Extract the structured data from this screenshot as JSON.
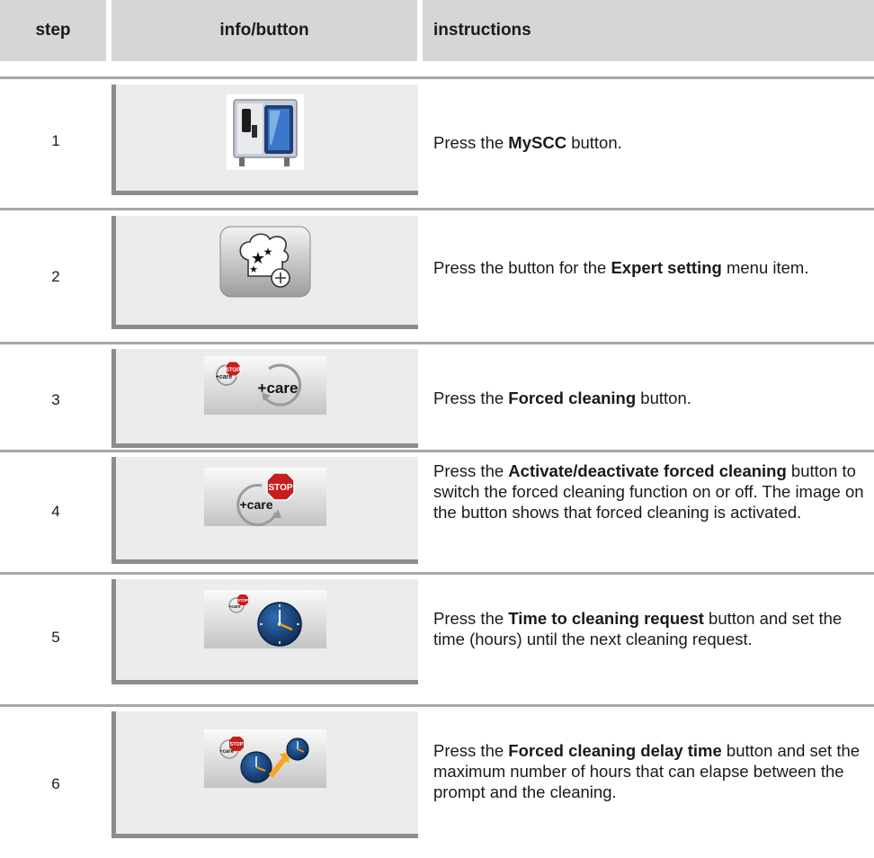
{
  "header": {
    "step": "step",
    "info": "info/button",
    "instructions": "instructions"
  },
  "rows": [
    {
      "step": "1",
      "pre": "Press the ",
      "bold": "MySCC",
      "post": " button.",
      "icon": "myscc-oven-icon"
    },
    {
      "step": "2",
      "pre": "Press the button for the ",
      "bold": "Expert setting",
      "post": " menu item.",
      "icon": "chef-hat-stars-plus-icon"
    },
    {
      "step": "3",
      "pre": "Press the ",
      "bold": "Forced cleaning",
      "post": " button.",
      "icon": "care-stop-cycle-icon"
    },
    {
      "step": "4",
      "pre": "Press the ",
      "bold": "Activate/deactivate forced cleaning",
      "post": " button to switch the forced cleaning function on or off. The image on the button shows that forced cleaning is activated.",
      "icon": "care-stop-large-icon"
    },
    {
      "step": "5",
      "pre": "Press the ",
      "bold": "Time to cleaning request",
      "post": " button and set the time (hours) until the next cleaning request.",
      "icon": "care-stop-clock-icon"
    },
    {
      "step": "6",
      "pre": "Press the ",
      "bold": "Forced cleaning delay time",
      "post": " button and set the maximum number of hours that can elapse between the prompt and the cleaning.",
      "icon": "care-stop-two-clocks-icon"
    }
  ],
  "icon_labels": {
    "stop": "STOP",
    "care": "care"
  }
}
